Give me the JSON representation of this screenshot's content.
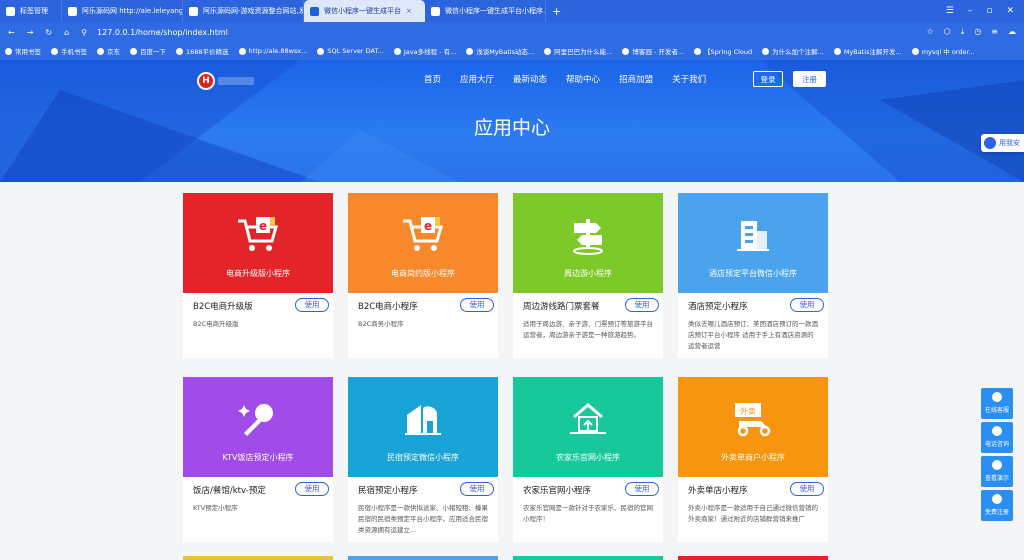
{
  "browser": {
    "tabs": [
      {
        "label": "标签管理",
        "active": false
      },
      {
        "label": "阿乐源码网 http://ale.leleyang...",
        "active": false
      },
      {
        "label": "阿乐源码网-游戏资源整合网站,发...",
        "active": false
      },
      {
        "label": "微信小程序一键生成平台",
        "active": true
      },
      {
        "label": "微信小程序一键生成平台小程序...",
        "active": false
      }
    ],
    "new_tab": "+",
    "url": "127.0.0.1/home/shop/index.html",
    "bookmarks": [
      "常用书签",
      "手机书签",
      "京东",
      "百度一下",
      "1688平价精选",
      "http://ale.88wsx...",
      "SQL Server DAT...",
      "Java多线程 - 有...",
      "浅谈MyBatis动态...",
      "阿里巴巴为什么能...",
      "博客园 - 开发者...",
      "【Spring Cloud",
      "为什么加个注解...",
      "MyBatis注解开发...",
      "mysql 中 order..."
    ]
  },
  "site": {
    "logo_letter": "H",
    "nav": [
      "首页",
      "应用大厅",
      "最新动态",
      "帮助中心",
      "招商加盟",
      "关于我们"
    ],
    "login": "登录",
    "register": "注册",
    "hero_title": "应用中心",
    "share_label": "用我安"
  },
  "cards": [
    {
      "caption": "电商升级版小程序",
      "name": "B2C电商升级版",
      "use": "使用",
      "desc": "B2C电商升级版",
      "color": "#e3252a",
      "icon": "cart-e-icon"
    },
    {
      "caption": "电商简约版小程序",
      "name": "B2C电商小程序",
      "use": "使用",
      "desc": "B2C商务小程序",
      "color": "#f7882c",
      "icon": "cart-e-icon"
    },
    {
      "caption": "周边游小程序",
      "name": "周边游线路门票套餐",
      "use": "使用",
      "desc": "适用于周边游、亲子游、门票预订等旅游平台运营者，周边游亲子游是一种旅游趋势。",
      "color": "#7ec92a",
      "icon": "signpost-icon"
    },
    {
      "caption": "酒店预定平台微信小程序",
      "name": "酒店预定小程序",
      "use": "使用",
      "desc": "类似去哪儿酒店预订、美团酒店预订的一款酒店预订平台小程序 适用于手上有酒店资源的运营者运营",
      "color": "#4ba3ee",
      "icon": "hotel-icon"
    },
    {
      "caption": "KTV饭店预定小程序",
      "name": "饭店/餐馆/ktv-预定",
      "use": "使用",
      "desc": "KTV预定小程序",
      "color": "#a14be8",
      "icon": "microphone-icon"
    },
    {
      "caption": "民宿预定微信小程序",
      "name": "民宿预定小程序",
      "use": "使用",
      "desc": "民宿小程序是一款供拟途家、小猪短租、榛果民宿的民宿类预定平台小程序，应用适合民宿类资源拥有运建立...",
      "color": "#1aa3d6",
      "icon": "house-icon"
    },
    {
      "caption": "农家乐官网小程序",
      "name": "农家乐官网小程序",
      "use": "使用",
      "desc": "农家乐官网是一款针对于农家乐、民宿的官网小程序！",
      "color": "#17c99a",
      "icon": "farmhouse-icon"
    },
    {
      "caption": "外卖单商户小程序",
      "name": "外卖单店小程序",
      "use": "使用",
      "desc": "外卖小程序是一款适用于自己通过微信营销的外卖商家！通过附近的店铺群营销来推广",
      "color": "#f7950f",
      "icon": "delivery-icon"
    }
  ],
  "side_buttons": [
    "在线客服",
    "电话咨询",
    "查看演示",
    "免费注册"
  ]
}
